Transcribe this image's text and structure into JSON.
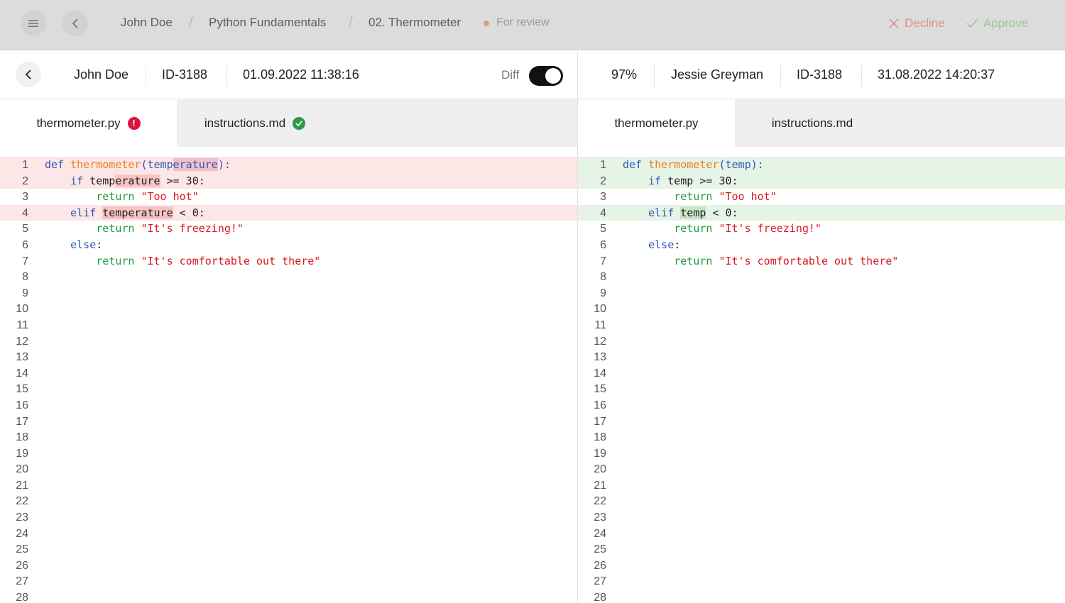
{
  "topbar": {
    "breadcrumbs": [
      "John Doe",
      "Python Fundamentals",
      "02. Thermometer"
    ],
    "separator": "/",
    "status": "For review",
    "decline_label": "Decline",
    "approve_label": "Approve"
  },
  "left": {
    "student": "John Doe",
    "id": "ID-3188",
    "timestamp": "01.09.2022 11:38:16",
    "diff_label": "Diff",
    "diff_on": true,
    "tabs": [
      {
        "label": "thermometer.py",
        "badge": "!"
      },
      {
        "label": "instructions.md",
        "badge": "ok"
      }
    ],
    "code": {
      "l1": {
        "kw": "def ",
        "fn": "thermometer",
        "p1": "(",
        "a": "temp",
        "b": "erature",
        "p2": "):"
      },
      "l2": {
        "ind": "    ",
        "kw": "if ",
        "a": "temp",
        "b": "erature",
        "rest": " >= 30:"
      },
      "l3": {
        "ind": "        ",
        "rt": "return ",
        "str": "\"Too hot\""
      },
      "l4": {
        "ind": "    ",
        "kw": "elif ",
        "v": "temperature",
        "rest": " < 0:"
      },
      "l5": {
        "ind": "        ",
        "rt": "return ",
        "str": "\"It's freezing!\""
      },
      "l6": {
        "ind": "    ",
        "kw": "else",
        "rest": ":"
      },
      "l7": {
        "ind": "        ",
        "rt": "return ",
        "str": "\"It's comfortable out there\""
      }
    }
  },
  "right": {
    "score": "97%",
    "reviewer": "Jessie Greyman",
    "id": "ID-3188",
    "timestamp": "31.08.2022 14:20:37",
    "tabs": [
      {
        "label": "thermometer.py"
      },
      {
        "label": "instructions.md"
      }
    ],
    "code": {
      "l1": {
        "kw": "def ",
        "fn": "thermometer",
        "p": "(temp):"
      },
      "l2": {
        "ind": "    ",
        "kw": "if ",
        "rest": "temp >= 30:"
      },
      "l3": {
        "ind": "        ",
        "rt": "return ",
        "str": "\"Too hot\""
      },
      "l4": {
        "ind": "    ",
        "kw": "elif ",
        "v": "temp",
        "rest": " < 0:"
      },
      "l5": {
        "ind": "        ",
        "rt": "return ",
        "str": "\"It's freezing!\""
      },
      "l6": {
        "ind": "    ",
        "kw": "else",
        "rest": ":"
      },
      "l7": {
        "ind": "        ",
        "rt": "return ",
        "str": "\"It's comfortable out there\""
      }
    }
  },
  "line_numbers": [
    "1",
    "2",
    "3",
    "4",
    "5",
    "6",
    "7",
    "8",
    "9",
    "10",
    "11",
    "12",
    "13",
    "14",
    "15",
    "16",
    "17",
    "18",
    "19",
    "20",
    "21",
    "22",
    "23",
    "24",
    "25",
    "26",
    "27",
    "28"
  ],
  "colors": {
    "keyword": "#2e56b8",
    "function": "#ed7e1c",
    "return": "#1f9c3a",
    "string": "#d9191e",
    "deleted_bg": "#fde6e6",
    "added_bg": "#e6f4e6",
    "error_badge": "#d9153a",
    "ok_badge": "#2f9a4d"
  },
  "icons": [
    "menu-icon",
    "chevron-left-icon",
    "close-icon",
    "check-icon",
    "alert-icon"
  ]
}
